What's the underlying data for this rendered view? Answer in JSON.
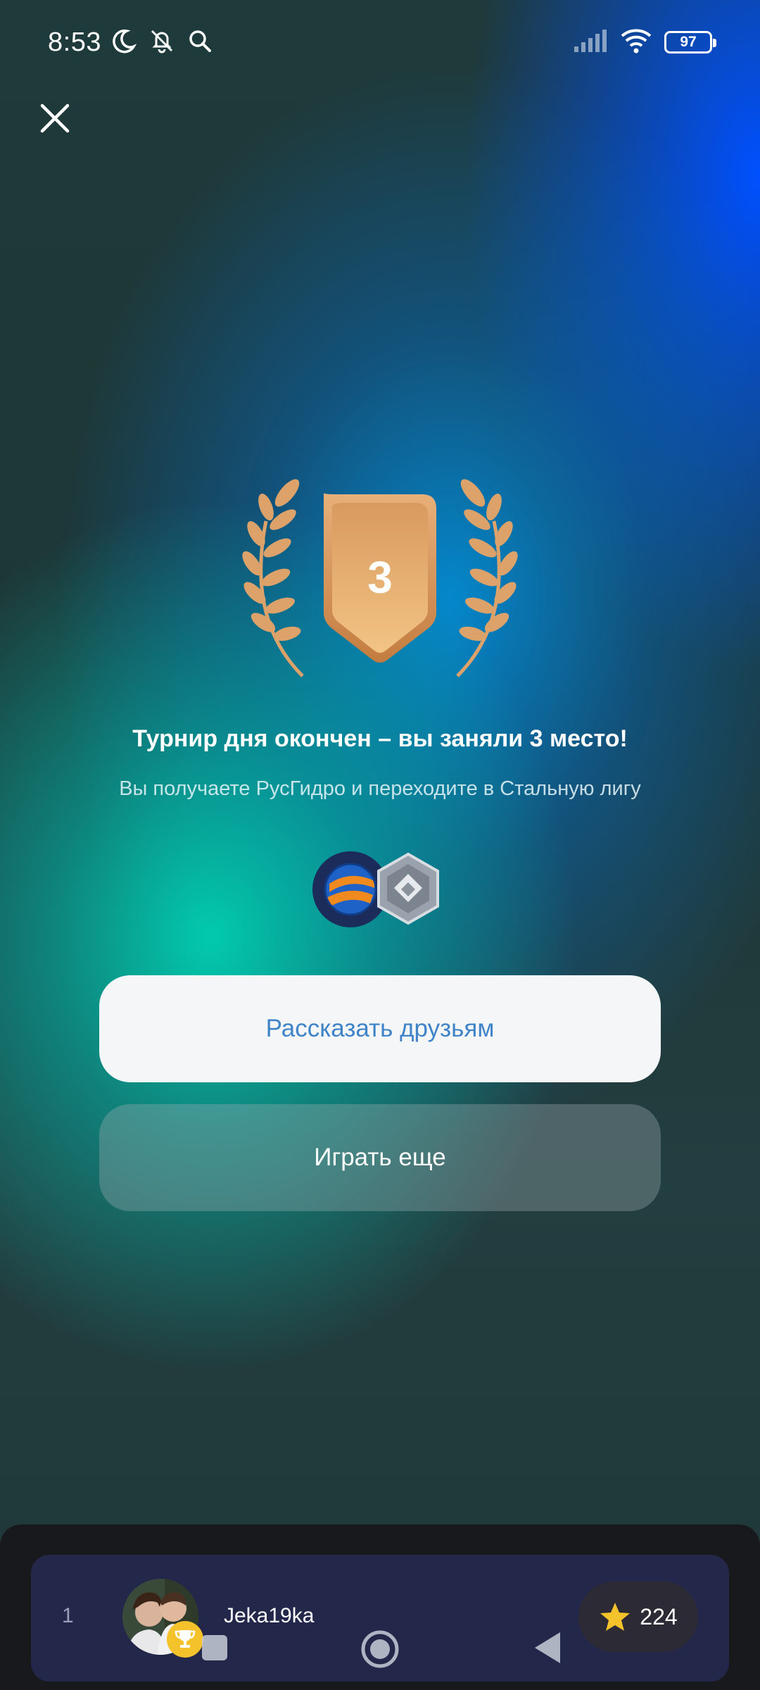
{
  "status_bar": {
    "time": "8:53",
    "battery": "97",
    "icons": [
      "moon-icon",
      "bell-off-icon",
      "search-icon",
      "signal-icon",
      "wifi-icon",
      "battery-icon"
    ]
  },
  "result": {
    "place": "3",
    "headline": "Турнир дня окончен – вы заняли 3 место!",
    "subline": "Вы получаете РусГидро и переходите в Стальную лигу"
  },
  "buttons": {
    "share": "Рассказать друзьям",
    "play_again": "Играть еще"
  },
  "leaderboard": {
    "rank": "1",
    "username": "Jeka19ka",
    "score": "224"
  },
  "colors": {
    "medal": "#e1a46a",
    "laurel": "#d9a06a",
    "accent_text": "#3f84c8",
    "star": "#f4c22b"
  }
}
